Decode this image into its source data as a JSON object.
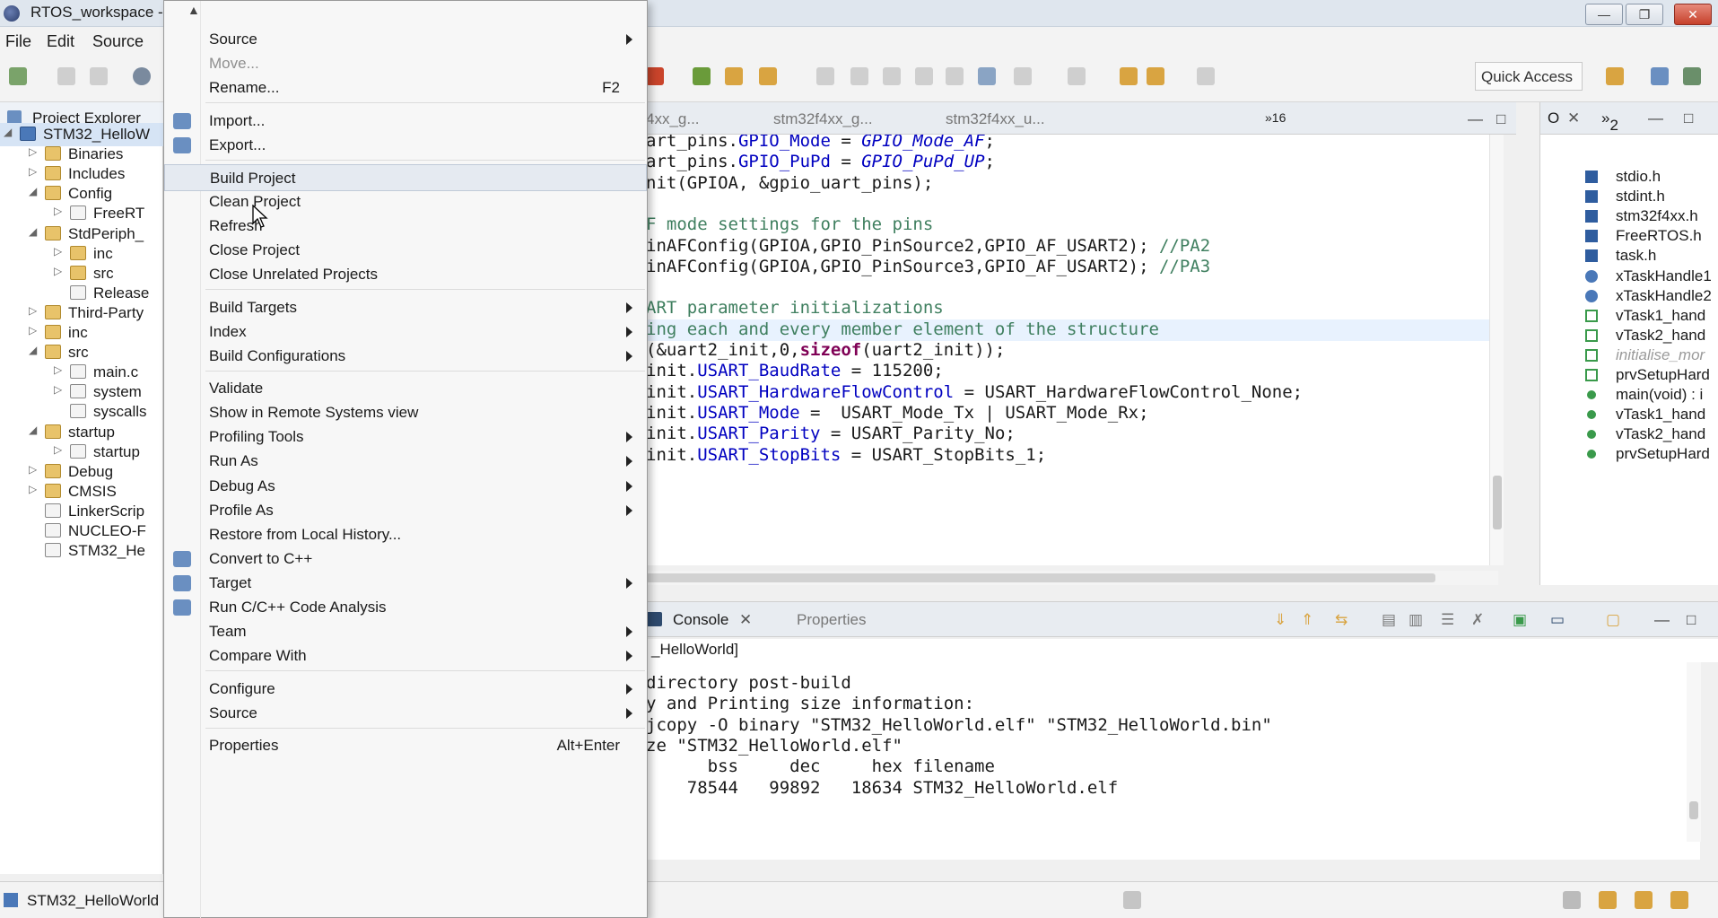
{
  "window": {
    "title": "RTOS_workspace -"
  },
  "menubar": [
    "File",
    "Edit",
    "Source"
  ],
  "quick_access": "Quick Access",
  "explorer": {
    "tab_label": "Project Explorer",
    "items": [
      {
        "label": "STM32_HelloW",
        "level": 0,
        "type": "proj",
        "expanded": true
      },
      {
        "label": "Binaries",
        "level": 1,
        "type": "folder",
        "expanded": false
      },
      {
        "label": "Includes",
        "level": 1,
        "type": "folder",
        "expanded": false
      },
      {
        "label": "Config",
        "level": 1,
        "type": "folder",
        "expanded": true
      },
      {
        "label": "FreeRT",
        "level": 2,
        "type": "file",
        "expanded": false
      },
      {
        "label": "StdPeriph_",
        "level": 1,
        "type": "folder",
        "expanded": true
      },
      {
        "label": "inc",
        "level": 2,
        "type": "folder",
        "expanded": false
      },
      {
        "label": "src",
        "level": 2,
        "type": "folder",
        "expanded": false
      },
      {
        "label": "Release",
        "level": 2,
        "type": "file",
        "expanded": null
      },
      {
        "label": "Third-Party",
        "level": 1,
        "type": "folder",
        "expanded": false
      },
      {
        "label": "inc",
        "level": 1,
        "type": "folder",
        "expanded": false
      },
      {
        "label": "src",
        "level": 1,
        "type": "folder",
        "expanded": true
      },
      {
        "label": "main.c",
        "level": 2,
        "type": "file",
        "expanded": false
      },
      {
        "label": "system",
        "level": 2,
        "type": "file",
        "expanded": false
      },
      {
        "label": "syscalls",
        "level": 2,
        "type": "file",
        "expanded": null
      },
      {
        "label": "startup",
        "level": 1,
        "type": "folder",
        "expanded": true
      },
      {
        "label": "startup",
        "level": 2,
        "type": "file",
        "expanded": false
      },
      {
        "label": "Debug",
        "level": 1,
        "type": "folder",
        "expanded": false
      },
      {
        "label": "CMSIS",
        "level": 1,
        "type": "folder",
        "expanded": false
      },
      {
        "label": "LinkerScrip",
        "level": 1,
        "type": "file",
        "expanded": null
      },
      {
        "label": "NUCLEO-F",
        "level": 1,
        "type": "file",
        "expanded": null
      },
      {
        "label": "STM32_He",
        "level": 1,
        "type": "file",
        "expanded": null
      }
    ],
    "status_label": "STM32_HelloWorld"
  },
  "context_menu": {
    "items": [
      {
        "label": "Source",
        "submenu": true
      },
      {
        "label": "Move...",
        "disabled": true
      },
      {
        "label": "Rename...",
        "shortcut": "F2"
      },
      {
        "sep": true
      },
      {
        "label": "Import...",
        "icon": true
      },
      {
        "label": "Export...",
        "icon": true
      },
      {
        "sep": true
      },
      {
        "label": "Build Project",
        "highlight": true
      },
      {
        "label": "Clean Project"
      },
      {
        "label": "Refresh"
      },
      {
        "label": "Close Project"
      },
      {
        "label": "Close Unrelated Projects"
      },
      {
        "sep": true
      },
      {
        "label": "Build Targets",
        "submenu": true
      },
      {
        "label": "Index",
        "submenu": true
      },
      {
        "label": "Build Configurations",
        "submenu": true
      },
      {
        "sep": true
      },
      {
        "label": "Validate"
      },
      {
        "label": "Show in Remote Systems view"
      },
      {
        "label": "Profiling Tools",
        "submenu": true
      },
      {
        "label": "Run As",
        "submenu": true
      },
      {
        "label": "Debug As",
        "submenu": true
      },
      {
        "label": "Profile As",
        "submenu": true
      },
      {
        "label": "Restore from Local History..."
      },
      {
        "label": "Convert to C++",
        "icon": true
      },
      {
        "label": "Target",
        "submenu": true,
        "icon": true
      },
      {
        "label": "Run C/C++ Code Analysis",
        "icon": true
      },
      {
        "label": "Team",
        "submenu": true
      },
      {
        "label": "Compare With",
        "submenu": true
      },
      {
        "sep": true
      },
      {
        "label": "Configure",
        "submenu": true
      },
      {
        "label": "Source",
        "submenu": true
      },
      {
        "sep": true
      },
      {
        "label": "Properties",
        "shortcut": "Alt+Enter"
      }
    ]
  },
  "editor": {
    "tabs": [
      "4xx_g...",
      "stm32f4xx_g...",
      "stm32f4xx_u..."
    ],
    "overflow": "16",
    "lines": [
      [
        {
          "t": "art_pins.",
          "c": ""
        },
        {
          "t": "GPIO_Mode",
          "c": "fld"
        },
        {
          "t": " = ",
          "c": ""
        },
        {
          "t": "GPIO_Mode_AF",
          "c": "it"
        },
        {
          "t": ";",
          "c": ""
        }
      ],
      [
        {
          "t": "art_pins.",
          "c": ""
        },
        {
          "t": "GPIO_PuPd",
          "c": "fld"
        },
        {
          "t": " = ",
          "c": ""
        },
        {
          "t": "GPIO_PuPd_UP",
          "c": "it"
        },
        {
          "t": ";",
          "c": ""
        }
      ],
      [
        {
          "t": "nit(GPIOA, &gpio_uart_pins);",
          "c": ""
        }
      ],
      [
        {
          "t": "",
          "c": ""
        }
      ],
      [
        {
          "t": "F mode settings for the pins",
          "c": "cmt"
        }
      ],
      [
        {
          "t": "inAFConfig(GPIOA,GPIO_PinSource2,GPIO_AF_USART2); ",
          "c": ""
        },
        {
          "t": "//PA2",
          "c": "cmt"
        }
      ],
      [
        {
          "t": "inAFConfig(GPIOA,GPIO_PinSource3,GPIO_AF_USART2); ",
          "c": ""
        },
        {
          "t": "//PA3",
          "c": "cmt"
        }
      ],
      [
        {
          "t": "",
          "c": ""
        }
      ],
      [
        {
          "t": "ART parameter initializations",
          "c": "cmt"
        }
      ],
      [
        {
          "t": "ing each and every member element of the structure",
          "c": "cmt"
        }
      ],
      [
        {
          "t": "(&uart2_init,0,",
          "c": ""
        },
        {
          "t": "sizeof",
          "c": "kw"
        },
        {
          "t": "(uart2_init));",
          "c": ""
        }
      ],
      [
        {
          "t": "init.",
          "c": ""
        },
        {
          "t": "USART_BaudRate",
          "c": "fld"
        },
        {
          "t": " = 115200;",
          "c": ""
        }
      ],
      [
        {
          "t": "init.",
          "c": ""
        },
        {
          "t": "USART_HardwareFlowControl",
          "c": "fld"
        },
        {
          "t": " = USART_HardwareFlowControl_None;",
          "c": ""
        }
      ],
      [
        {
          "t": "init.",
          "c": ""
        },
        {
          "t": "USART_Mode",
          "c": "fld"
        },
        {
          "t": " =  USART_Mode_Tx | USART_Mode_Rx;",
          "c": ""
        }
      ],
      [
        {
          "t": "init.",
          "c": ""
        },
        {
          "t": "USART_Parity",
          "c": "fld"
        },
        {
          "t": " = USART_Parity_No;",
          "c": ""
        }
      ],
      [
        {
          "t": "init.",
          "c": ""
        },
        {
          "t": "USART_StopBits",
          "c": "fld"
        },
        {
          "t": " = USART_StopBits_1;",
          "c": ""
        }
      ]
    ]
  },
  "outline": {
    "tabs": [
      "O",
      "2"
    ],
    "items": [
      {
        "label": "stdio.h",
        "kind": "header"
      },
      {
        "label": "stdint.h",
        "kind": "header"
      },
      {
        "label": "stm32f4xx.h",
        "kind": "header"
      },
      {
        "label": "FreeRTOS.h",
        "kind": "header"
      },
      {
        "label": "task.h",
        "kind": "header"
      },
      {
        "label": "xTaskHandle1",
        "kind": "var"
      },
      {
        "label": "xTaskHandle2",
        "kind": "var"
      },
      {
        "label": "vTask1_hand",
        "kind": "proto"
      },
      {
        "label": "vTask2_hand",
        "kind": "proto"
      },
      {
        "label": "initialise_mor",
        "kind": "proto",
        "gray": true
      },
      {
        "label": "prvSetupHard",
        "kind": "proto"
      },
      {
        "label": "main(void) : i",
        "kind": "func"
      },
      {
        "label": "vTask1_hand",
        "kind": "func"
      },
      {
        "label": "vTask2_hand",
        "kind": "func"
      },
      {
        "label": "prvSetupHard",
        "kind": "func"
      }
    ]
  },
  "console": {
    "tab_label": "Console",
    "properties_label": "Properties",
    "sub_label": "_HelloWorld]",
    "lines": [
      "directory post-build",
      "y and Printing size information:",
      "jcopy -O binary \"STM32_HelloWorld.elf\" \"STM32_HelloWorld.bin\"",
      "ze \"STM32_HelloWorld.elf\"",
      "      bss     dec     hex filename",
      "    78544   99892   18634 STM32_HelloWorld.elf"
    ]
  },
  "colors": {
    "accent": "#4a78b8",
    "menu_bg": "#f7f7f7",
    "highlight": "#e5eaf1"
  }
}
